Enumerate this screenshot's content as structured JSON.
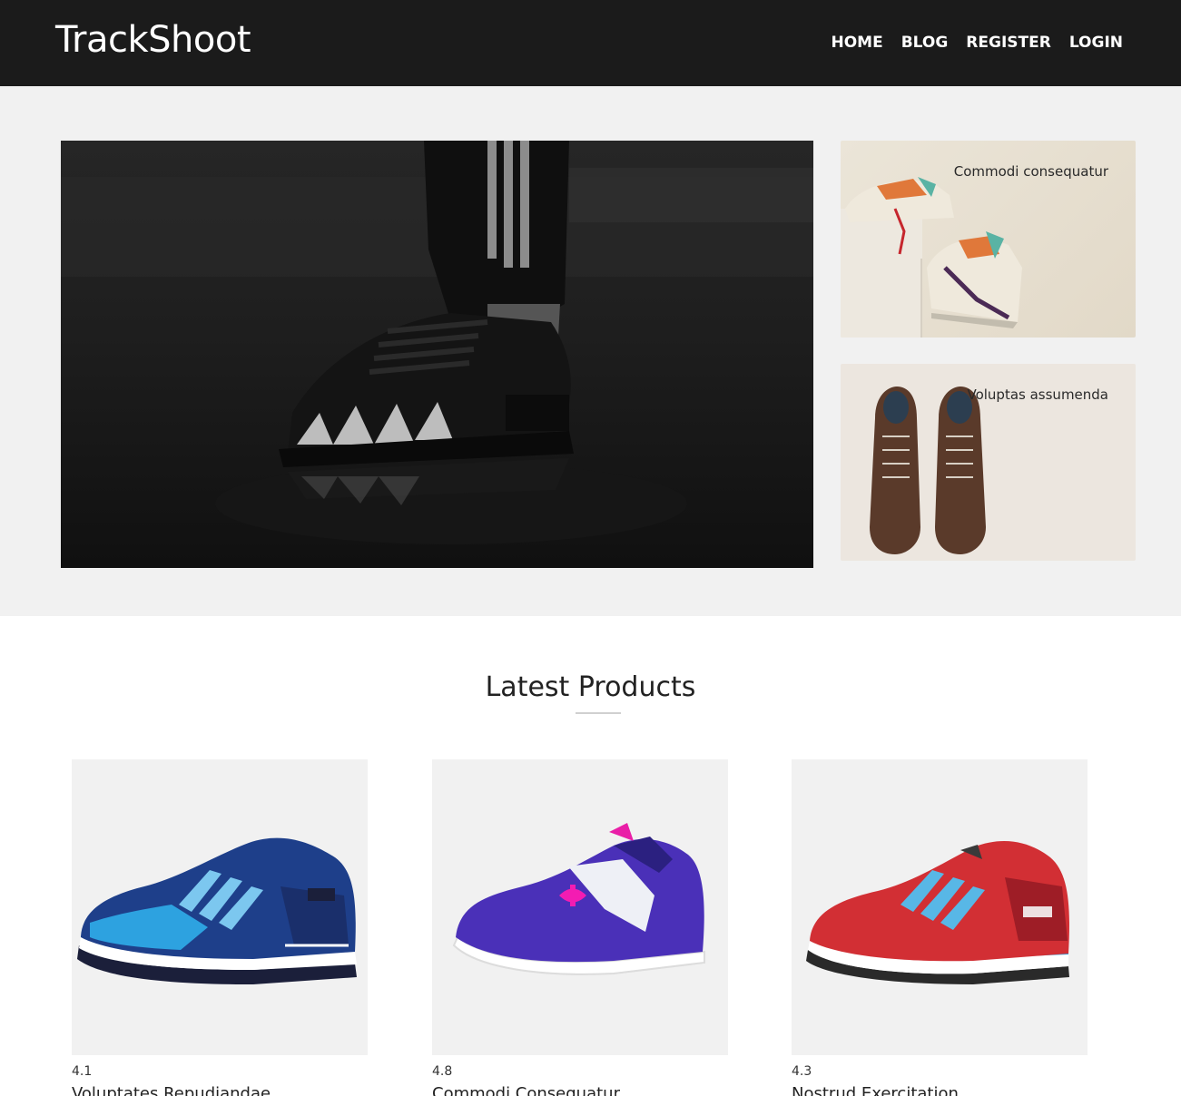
{
  "header": {
    "brand": "TrackShoot",
    "nav": [
      {
        "label": "HOME"
      },
      {
        "label": "BLOG"
      },
      {
        "label": "REGISTER"
      },
      {
        "label": "LOGIN"
      }
    ]
  },
  "hero": {
    "side_cards": [
      {
        "caption": "Commodi consequatur"
      },
      {
        "caption": "Voluptas assumenda"
      }
    ]
  },
  "latest": {
    "title": "Latest Products",
    "products": [
      {
        "rating": "4.1",
        "name": "Voluptates Repudiandae",
        "image": "blue-running-shoe"
      },
      {
        "rating": "4.8",
        "name": "Commodi Consequatur",
        "image": "purple-running-shoe"
      },
      {
        "rating": "4.3",
        "name": "Nostrud Exercitation",
        "image": "red-running-shoe"
      }
    ]
  },
  "colors": {
    "header_bg": "#1b1b1b",
    "hero_bg": "#f1f1f1",
    "card_bg": "#f1f1f1"
  }
}
